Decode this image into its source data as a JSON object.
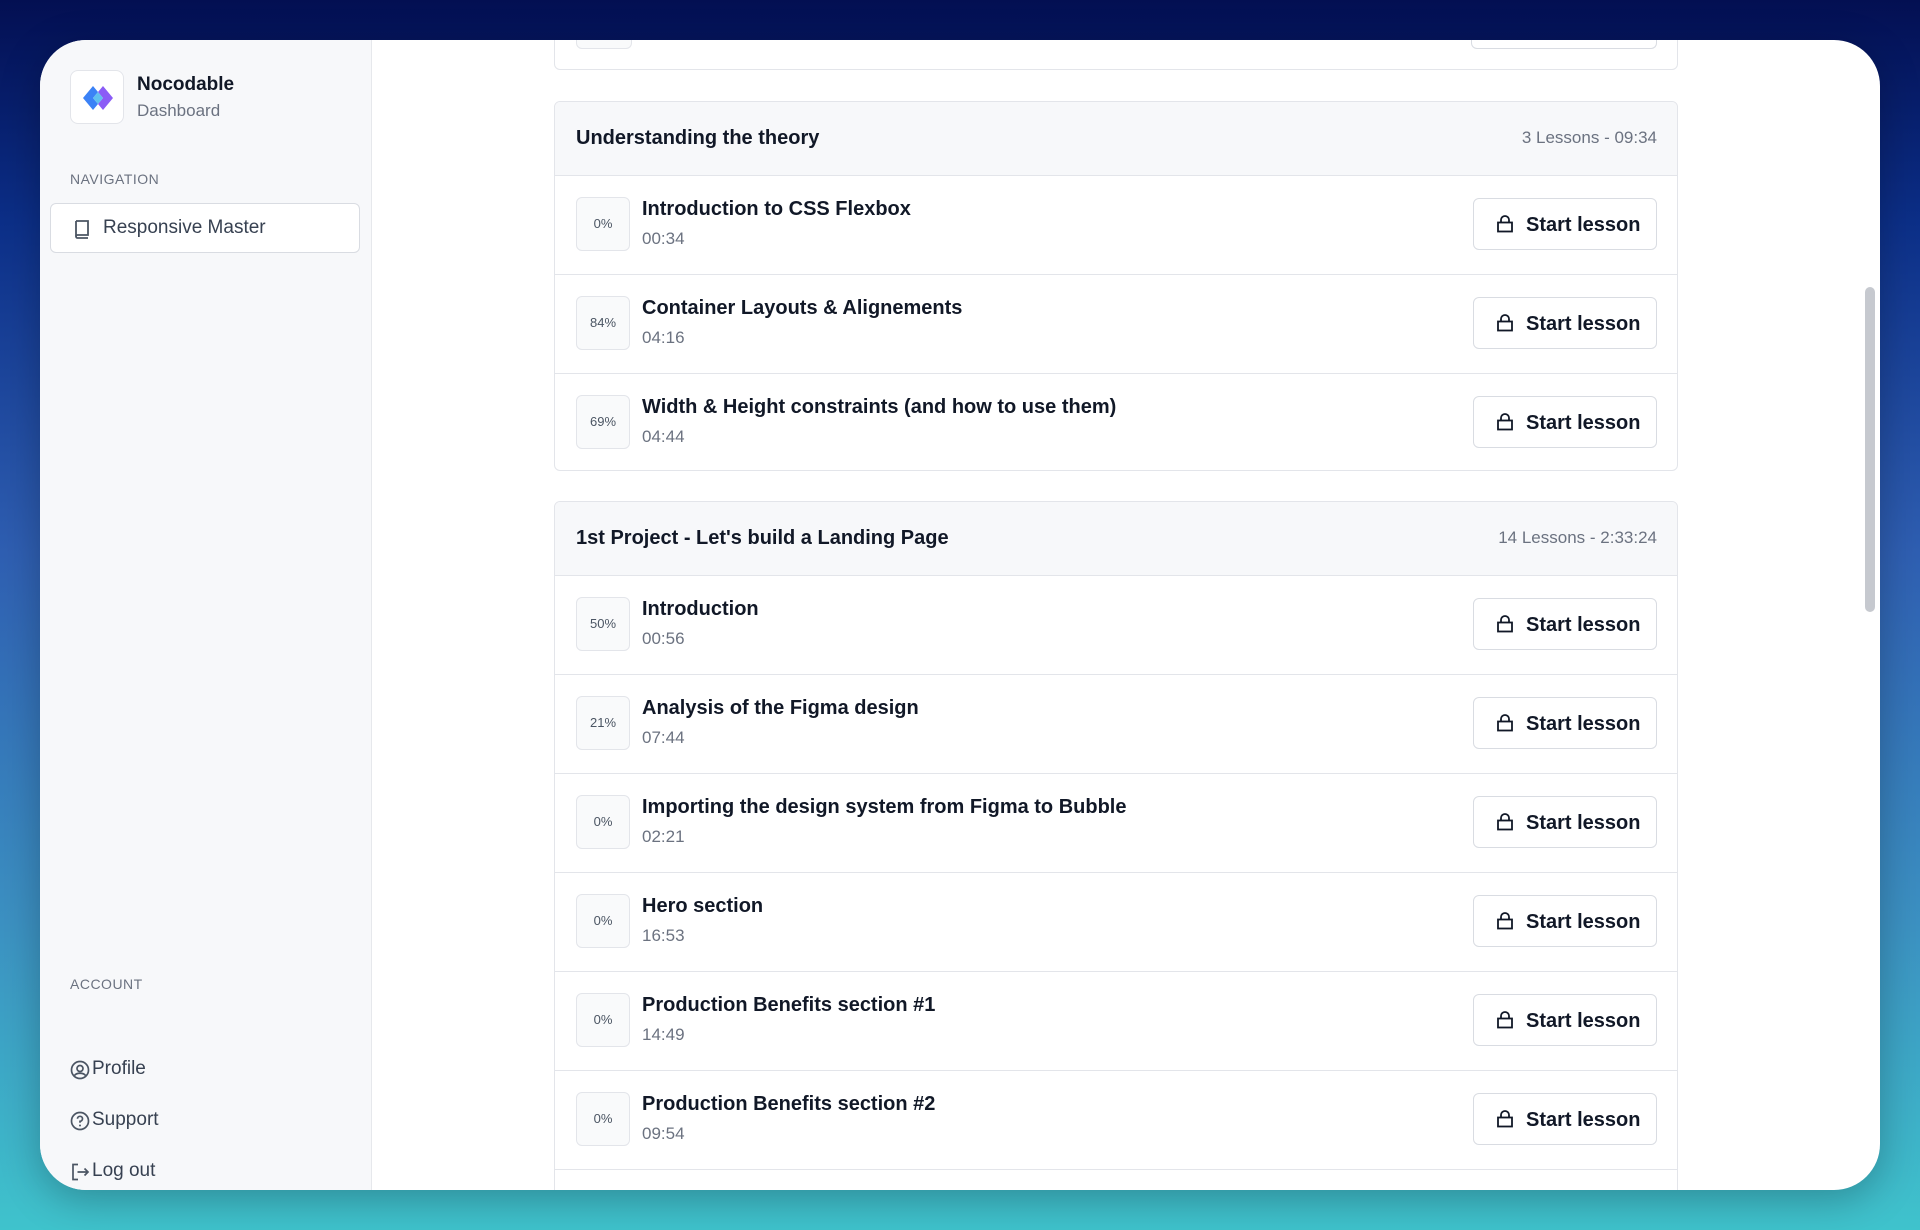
{
  "brand": {
    "name": "Nocodable",
    "subtitle": "Dashboard",
    "logo_icon": "nocodable-logo"
  },
  "navigation": {
    "label": "NAVIGATION",
    "items": [
      {
        "label": "Responsive Master",
        "icon": "book-icon"
      }
    ]
  },
  "account": {
    "label": "ACCOUNT",
    "items": [
      {
        "label": "Profile",
        "icon": "user-circle-icon"
      },
      {
        "label": "Support",
        "icon": "help-circle-icon"
      },
      {
        "label": "Log out",
        "icon": "logout-icon"
      }
    ]
  },
  "sections": [
    {
      "title": "Understanding the theory",
      "meta": "3 Lessons - 09:34",
      "lessons": [
        {
          "progress": "0%",
          "title": "Introduction to CSS Flexbox",
          "duration": "00:34",
          "button": "Start lesson"
        },
        {
          "progress": "84%",
          "title": "Container Layouts & Alignements",
          "duration": "04:16",
          "button": "Start lesson"
        },
        {
          "progress": "69%",
          "title": "Width & Height constraints (and how to use them)",
          "duration": "04:44",
          "button": "Start lesson"
        }
      ]
    },
    {
      "title": "1st Project - Let's build a Landing Page",
      "meta": "14 Lessons - 2:33:24",
      "lessons": [
        {
          "progress": "50%",
          "title": "Introduction",
          "duration": "00:56",
          "button": "Start lesson"
        },
        {
          "progress": "21%",
          "title": "Analysis of the Figma design",
          "duration": "07:44",
          "button": "Start lesson"
        },
        {
          "progress": "0%",
          "title": "Importing the design system from Figma to Bubble",
          "duration": "02:21",
          "button": "Start lesson"
        },
        {
          "progress": "0%",
          "title": "Hero section",
          "duration": "16:53",
          "button": "Start lesson"
        },
        {
          "progress": "0%",
          "title": "Production Benefits section #1",
          "duration": "14:49",
          "button": "Start lesson"
        },
        {
          "progress": "0%",
          "title": "Production Benefits section #2",
          "duration": "09:54",
          "button": "Start lesson"
        }
      ]
    }
  ],
  "colors": {
    "accent_blue": "#3b82f6",
    "text": "#111827",
    "muted": "#6b7280",
    "border": "#e3e5ea"
  }
}
